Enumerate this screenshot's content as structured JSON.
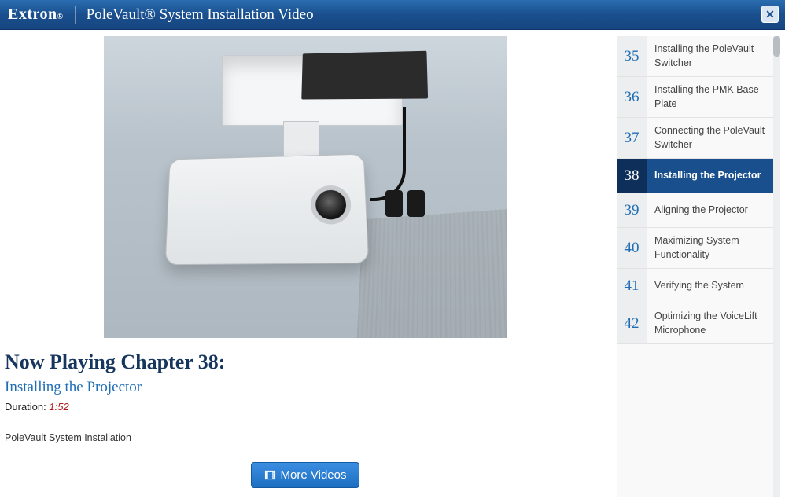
{
  "header": {
    "brand": "Extron",
    "title": "PoleVault® System Installation Video"
  },
  "nowPlaying": {
    "heading": "Now Playing Chapter 38:",
    "subtitle": "Installing the Projector",
    "durationLabel": "Duration:",
    "duration": "1:52",
    "series": "PoleVault System Installation"
  },
  "moreVideos": "More Videos",
  "playlist": [
    {
      "num": "35",
      "label": "Installing the PoleVault Switcher",
      "active": false
    },
    {
      "num": "36",
      "label": "Installing the PMK Base Plate",
      "active": false
    },
    {
      "num": "37",
      "label": "Connecting the PoleVault Switcher",
      "active": false
    },
    {
      "num": "38",
      "label": "Installing the Projector",
      "active": true
    },
    {
      "num": "39",
      "label": "Aligning the Projector",
      "active": false
    },
    {
      "num": "40",
      "label": "Maximizing System Functionality",
      "active": false
    },
    {
      "num": "41",
      "label": "Verifying the System",
      "active": false
    },
    {
      "num": "42",
      "label": "Optimizing the VoiceLift Microphone",
      "active": false
    }
  ]
}
